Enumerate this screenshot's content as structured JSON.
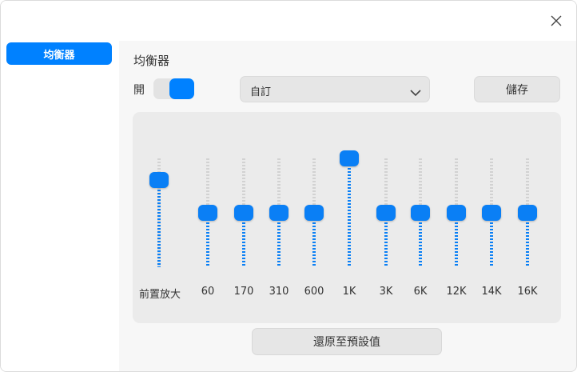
{
  "window": {
    "close_icon": "close-icon"
  },
  "sidebar": {
    "items": [
      {
        "label": "均衡器",
        "active": true
      }
    ]
  },
  "main": {
    "title": "均衡器",
    "power": {
      "label": "開",
      "on": true
    },
    "preset": {
      "value": "自訂",
      "icon": "chevron-down-icon"
    },
    "save_label": "儲存",
    "reset_label": "還原至預設值",
    "accent_color": "#0081ff"
  },
  "bands": [
    {
      "label": "前置放大",
      "level": 0.8
    },
    {
      "label": "60",
      "level": 0.5
    },
    {
      "label": "170",
      "level": 0.5
    },
    {
      "label": "310",
      "level": 0.5
    },
    {
      "label": "600",
      "level": 0.5
    },
    {
      "label": "1K",
      "level": 1.0
    },
    {
      "label": "3K",
      "level": 0.5
    },
    {
      "label": "6K",
      "level": 0.5
    },
    {
      "label": "12K",
      "level": 0.5
    },
    {
      "label": "14K",
      "level": 0.5
    },
    {
      "label": "16K",
      "level": 0.5
    }
  ]
}
